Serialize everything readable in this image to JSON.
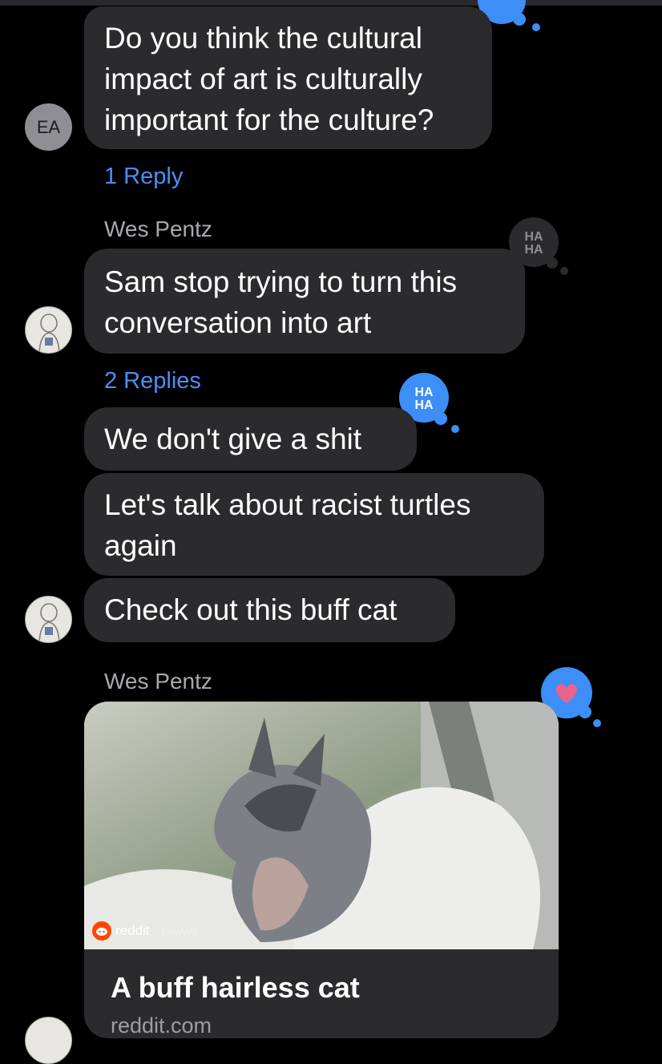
{
  "messages": [
    {
      "lines": [
        "Do you think the cultural",
        "impact of art is culturally",
        "important for the culture?"
      ]
    },
    {
      "lines": [
        "Sam stop trying to turn this",
        "conversation into art"
      ]
    },
    {
      "lines": [
        "We don't give a shit"
      ]
    },
    {
      "lines": [
        "Let's talk about racist turtles",
        "again"
      ]
    },
    {
      "lines": [
        "Check out this buff cat"
      ]
    }
  ],
  "avatars": {
    "ea": "EA"
  },
  "senders": [
    "Wes Pentz",
    "Wes Pentz"
  ],
  "replies": [
    "1 Reply",
    "2 Replies"
  ],
  "reactions": {
    "haha_text": "HA HA",
    "heart": "heart-reaction",
    "colors": {
      "blue": "#3d8ef6",
      "dark": "#2b2b2d",
      "heart": "#e8638c"
    }
  },
  "link_preview": {
    "source_name": "reddit",
    "separator": "·",
    "subreddit": "r/awwtf",
    "title": "A buff hairless cat",
    "domain": "reddit.com"
  }
}
